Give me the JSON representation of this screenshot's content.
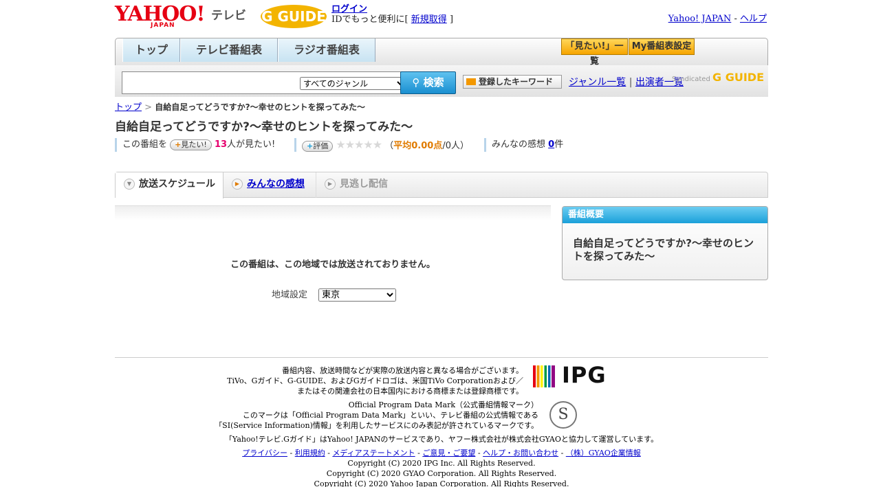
{
  "header": {
    "yahoo_logo_text": "YAHOO!",
    "yahoo_logo_sub": "JAPAN",
    "tv_label": "テレビ",
    "gguide_logo_text": "G GUIDE",
    "login_label": "ログイン",
    "login_desc_prefix": "IDでもっと便利に[",
    "register_label": "新規取得",
    "login_desc_suffix": "]",
    "yahoo_japan_link": "Yahoo! JAPAN",
    "dash": "-",
    "help_link": "ヘルプ"
  },
  "nav": {
    "tabs": [
      {
        "label": "トップ"
      },
      {
        "label": "テレビ番組表"
      },
      {
        "label": "ラジオ番組表"
      }
    ],
    "want_list_label": "「見たい!」一覧",
    "my_settings_label": "My番組表設定"
  },
  "search": {
    "input_value": "",
    "genre_options": [
      "すべてのジャンル"
    ],
    "search_button_label": "検索",
    "keyword_button_label": "登録したキーワード",
    "genre_list_link": "ジャンル一覧",
    "separator": "|",
    "cast_list_link": "出演者一覧",
    "syndicated_label": "Syndicated",
    "syndicated_logo": "G GUIDE"
  },
  "breadcrumb": {
    "home": "トップ",
    "sep": ">",
    "current": "自給自足ってどうですか?～幸せのヒントを探ってみた～"
  },
  "program": {
    "title": "自給自足ってどうですか?～幸せのヒントを探ってみた～",
    "want_prefix": "この番組を",
    "want_button_label": "見たい!",
    "want_count": "13",
    "want_suffix": "人が見たい!",
    "rate_button_label": "評価",
    "stars": "★★★★★",
    "avg_open": "（",
    "avg_label": "平均0.00点",
    "avg_count": "/0人）",
    "impressions_prefix": "みんなの感想",
    "impressions_count": "0",
    "impressions_suffix": "件"
  },
  "tabs": {
    "schedule": "放送スケジュール",
    "impressions": "みんなの感想",
    "missed": "見逃し配信"
  },
  "main": {
    "notice": "この番組は、この地域では放送されておりません。",
    "region_label": "地域設定",
    "region_value": "東京"
  },
  "sidebar": {
    "header": "番組概要",
    "body": "自給自足ってどうですか?～幸せのヒントを探ってみた～"
  },
  "footer": {
    "ipg_line1": "番組内容、放送時間などが実際の放送内容と異なる場合がございます。",
    "ipg_line2": "TiVo、Gガイド、G-GUIDE、およびGガイドロゴは、米国TiVo Corporationおよび／",
    "ipg_line3": "またはその関連会社の日本国内における商標または登録商標です。",
    "ipg_logo_text": "IPG",
    "mark_line1": "Official Program Data Mark（公式番組情報マーク）",
    "mark_line2": "このマークは「Official Program Data Mark」といい、テレビ番組の公式情報である",
    "mark_line3": "「SI(Service Information)情報」を利用したサービスにのみ表記が許されているマークです。",
    "seal_text": "S",
    "service_line": "「Yahoo!テレビ.Gガイド」はYahoo! JAPANのサービスであり、ヤフー株式会社が株式会社GYAOと協力して運営しています。",
    "links": [
      "プライバシー",
      "利用規約",
      "メディアステートメント",
      "ご意見・ご要望",
      "ヘルプ・お問い合わせ",
      "（株）GYAO企業情報"
    ],
    "link_sep": "-",
    "copyright1": "Copyright (C) 2020 IPG Inc. All Rights Reserved.",
    "copyright2": "Copyright (C) 2020 GYAO Corporation. All Rights Reserved.",
    "copyright3": "Copyright (C) 2020 Yahoo Japan Corporation. All Rights Reserved."
  },
  "colors": {
    "accent_blue": "#1a9fd8",
    "yahoo_red": "#e60013",
    "want_pink": "#e6006e",
    "avg_orange": "#e07b00"
  }
}
